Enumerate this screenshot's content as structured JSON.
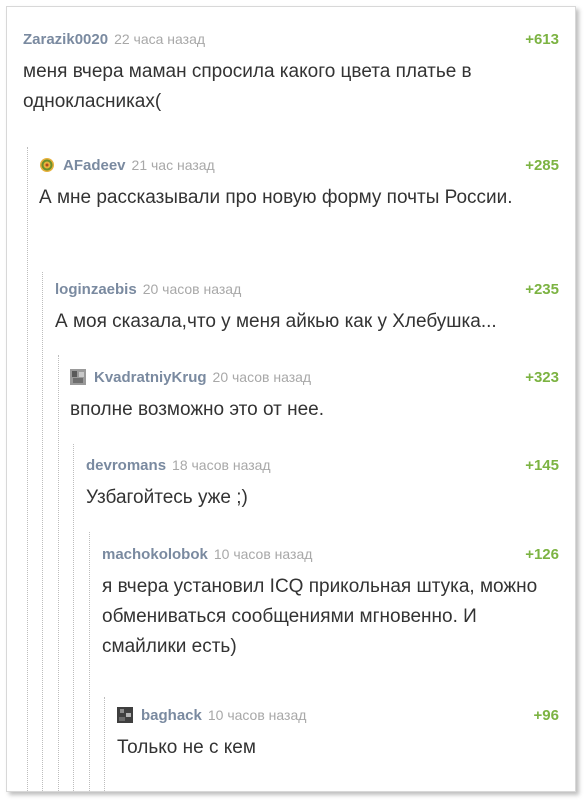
{
  "comments": [
    {
      "author": "Zarazik0020",
      "time": "22 часа назад",
      "rating": "+613",
      "text": "меня вчера маман спросила какого цвета платье в однокласниках("
    },
    {
      "author": "AFadeev",
      "time": "21 час назад",
      "rating": "+285",
      "text": "А мне рассказывали про новую форму почты России."
    },
    {
      "author": "loginzaebis",
      "time": "20 часов назад",
      "rating": "+235",
      "text": "А моя сказала,что у меня айкью как у Хлебушка..."
    },
    {
      "author": "KvadratniyKrug",
      "time": "20 часов назад",
      "rating": "+323",
      "text": "вполне возможно это от нее."
    },
    {
      "author": "devromans",
      "time": "18 часов назад",
      "rating": "+145",
      "text": "Узбагойтесь уже ;)"
    },
    {
      "author": "machokolobok",
      "time": "10 часов назад",
      "rating": "+126",
      "text": "я вчера установил ICQ прикольная штука, можно обмениваться сообщениями мгновенно. И смайлики есть)"
    },
    {
      "author": "baghack",
      "time": "10 часов назад",
      "rating": "+96",
      "text": "Только не с кем"
    }
  ],
  "colors": {
    "author": "#7a8aa0",
    "time": "#a8a8a8",
    "rating": "#7cb342",
    "thread_line": "#bdbdbd"
  }
}
